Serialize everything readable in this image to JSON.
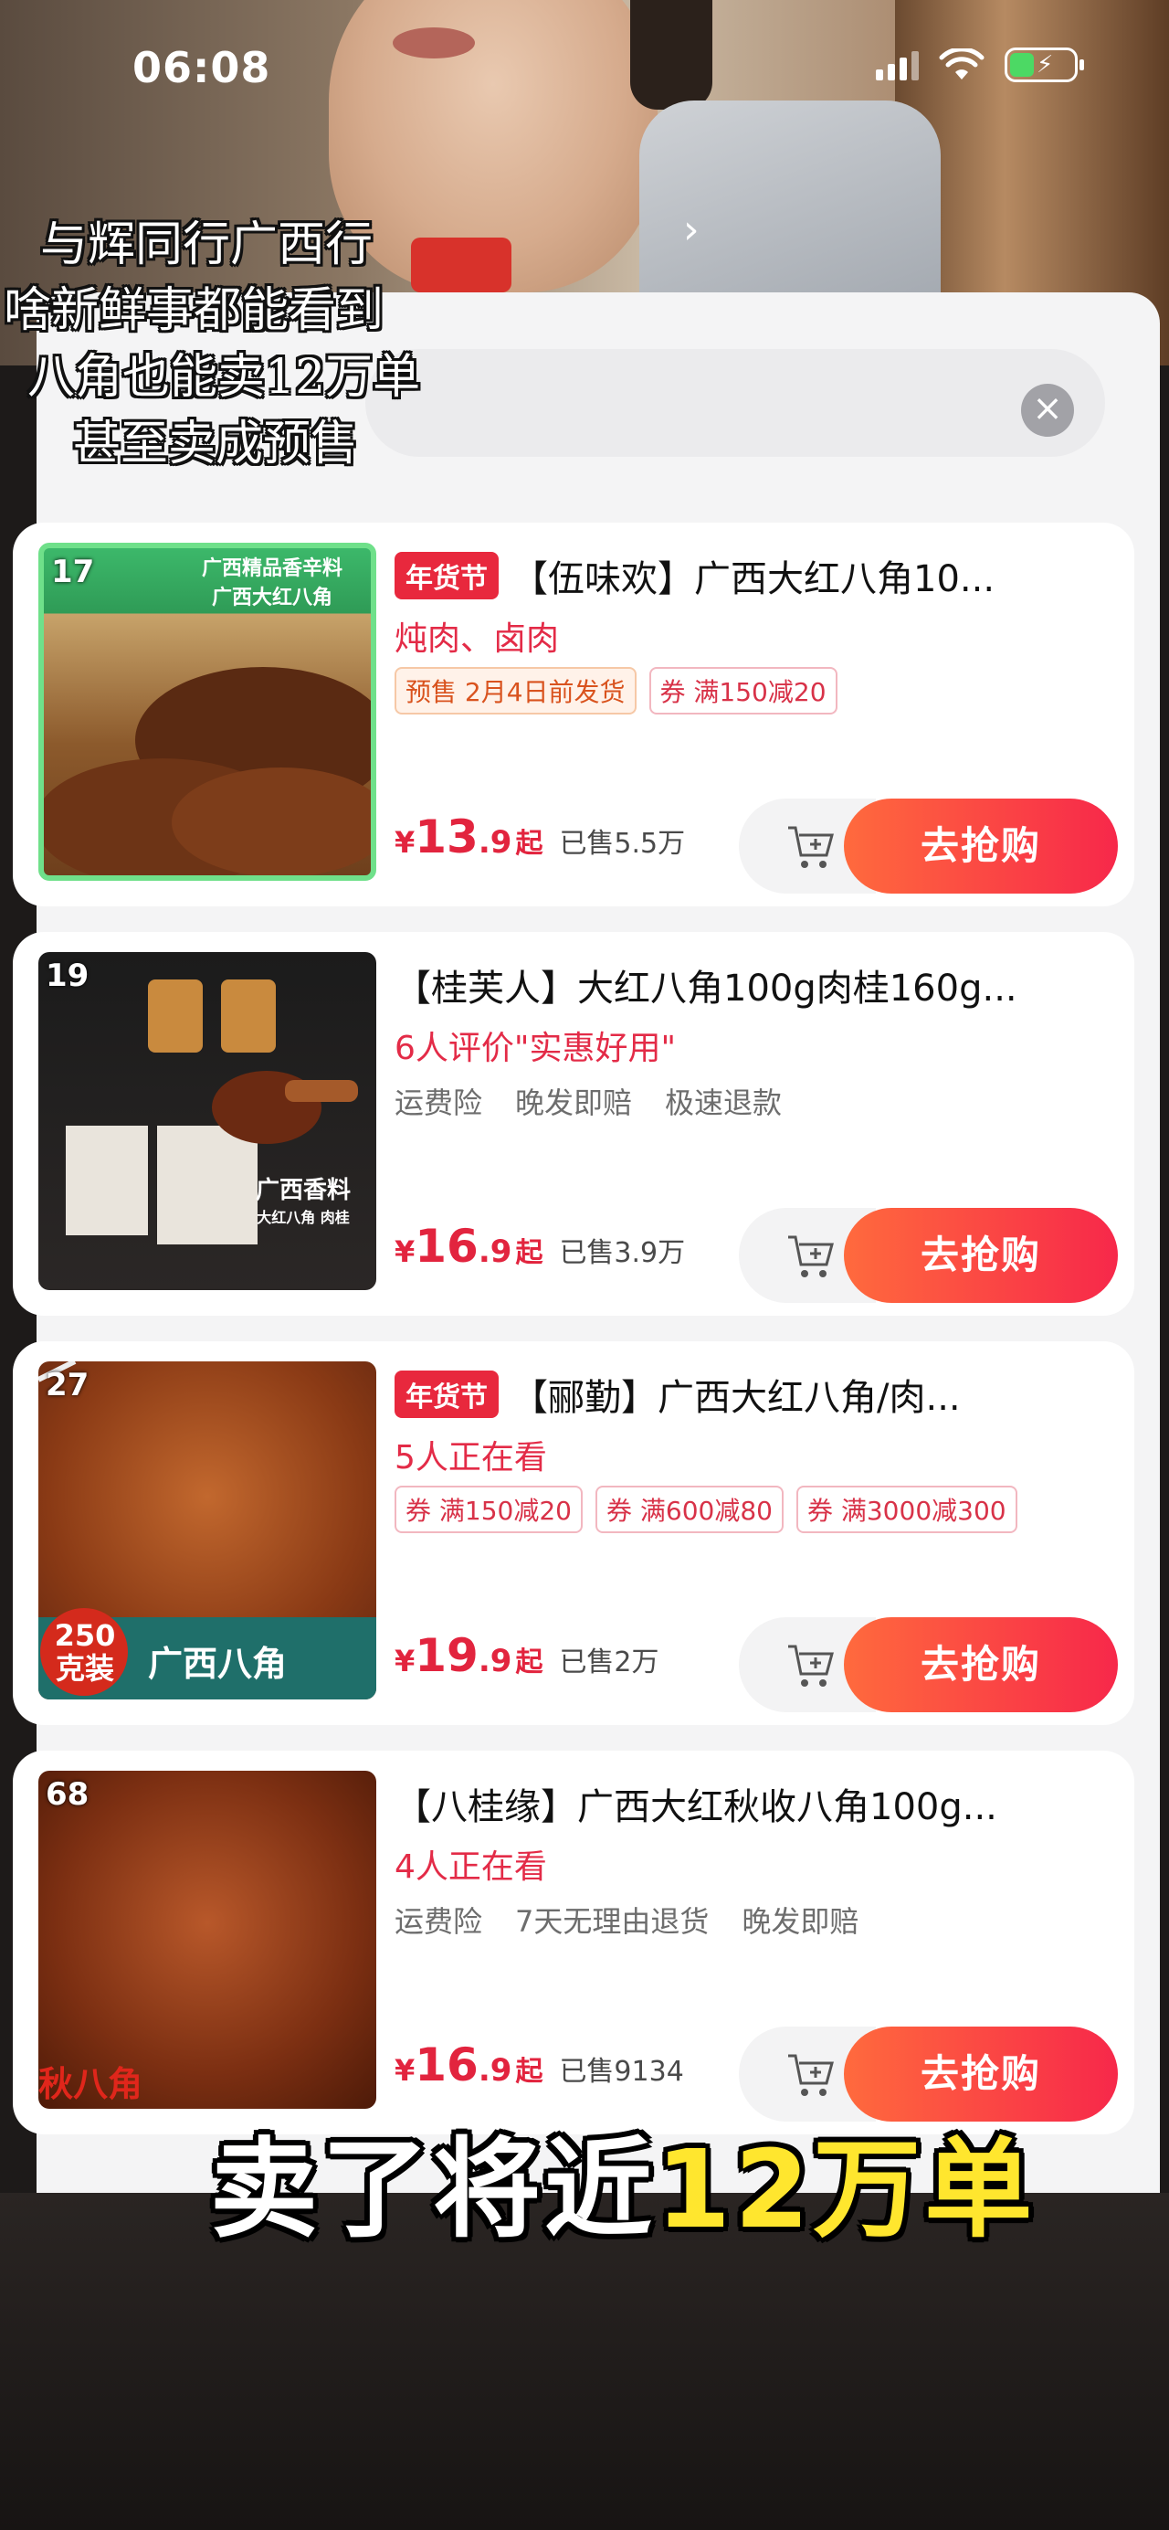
{
  "status_bar": {
    "time": "06:08"
  },
  "overlay_text": [
    "与辉同行广西行",
    "啥新鲜事都能看到",
    "八角也能卖12万单",
    "甚至卖成预售"
  ],
  "search": {
    "clear_icon": "×"
  },
  "products": [
    {
      "rank": "17",
      "badge": "年货节",
      "title": "【伍味欢】广西大红八角10...",
      "subline": "炖肉、卤肉",
      "chips": [
        {
          "text": "预售 2月4日前发货",
          "kind": "orange"
        },
        {
          "text": "券 满150减20",
          "kind": "coupon"
        }
      ],
      "services": [],
      "price_currency": "¥",
      "price_int": "13",
      "price_dec": ".9",
      "price_suffix": "起",
      "sold": "已售5.5万",
      "buy_label": "去抢购",
      "thumb_text": [
        "广西精品香辛料",
        "广西大红八角"
      ]
    },
    {
      "rank": "19",
      "badge": "",
      "title": "【桂芙人】大红八角100g肉桂160g...",
      "subline": "6人评价\"实惠好用\"",
      "chips": [],
      "services": [
        "运费险",
        "晚发即赔",
        "极速退款"
      ],
      "price_currency": "¥",
      "price_int": "16",
      "price_dec": ".9",
      "price_suffix": "起",
      "sold": "已售3.9万",
      "buy_label": "去抢购",
      "thumb_text": [
        "广西香料",
        "大红八角 肉桂"
      ]
    },
    {
      "rank": "27",
      "badge": "年货节",
      "title": "【郦勤】广西大红八角/肉...",
      "subline": "5人正在看",
      "chips": [
        {
          "text": "券 满150减20",
          "kind": "coupon"
        },
        {
          "text": "券 满600减80",
          "kind": "coupon"
        },
        {
          "text": "券 满3000减300",
          "kind": "coupon"
        }
      ],
      "services": [],
      "price_currency": "¥",
      "price_int": "19",
      "price_dec": ".9",
      "price_suffix": "起",
      "sold": "已售2万",
      "buy_label": "去抢购",
      "thumb_text": [
        "250克装",
        "广西八角"
      ]
    },
    {
      "rank": "68",
      "badge": "",
      "title": "【八桂缘】广西大红秋收八角100g...",
      "subline": "4人正在看",
      "chips": [],
      "services": [
        "运费险",
        "7天无理由退货",
        "晚发即赔"
      ],
      "price_currency": "¥",
      "price_int": "16",
      "price_dec": ".9",
      "price_suffix": "起",
      "sold": "已售9134",
      "buy_label": "去抢购",
      "thumb_text": [
        "秋八角"
      ]
    }
  ],
  "caption": {
    "prefix": "卖了将近",
    "highlight": "12万单"
  },
  "colors": {
    "accent": "#e8283d",
    "price": "#e2243e",
    "buy_start": "#ff6a3d",
    "buy_end": "#f7284a"
  },
  "icons": {
    "cart": "add-to-cart-icon",
    "clear": "close-icon",
    "back": "chevron-right-icon"
  }
}
